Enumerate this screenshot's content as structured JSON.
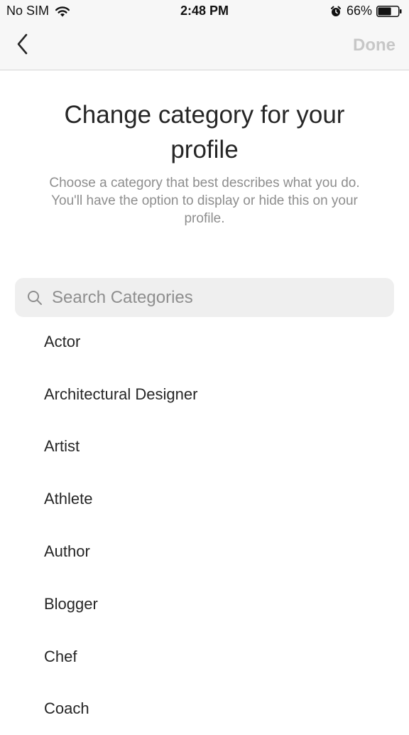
{
  "status_bar": {
    "carrier": "No SIM",
    "time": "2:48 PM",
    "battery_percent": "66%",
    "battery_level": 0.66
  },
  "nav": {
    "done_label": "Done"
  },
  "header": {
    "title": "Change category for your profile",
    "subtitle": "Choose a category that best describes what you do. You'll have the option to display or hide this on your profile."
  },
  "search": {
    "placeholder": "Search Categories",
    "value": ""
  },
  "categories": [
    "Actor",
    "Architectural Designer",
    "Artist",
    "Athlete",
    "Author",
    "Blogger",
    "Chef",
    "Coach"
  ],
  "colors": {
    "done_disabled": "#c7c7c7",
    "subtitle_gray": "#8e8e8e",
    "search_bg": "#efefef",
    "top_bg": "#f7f7f7"
  }
}
